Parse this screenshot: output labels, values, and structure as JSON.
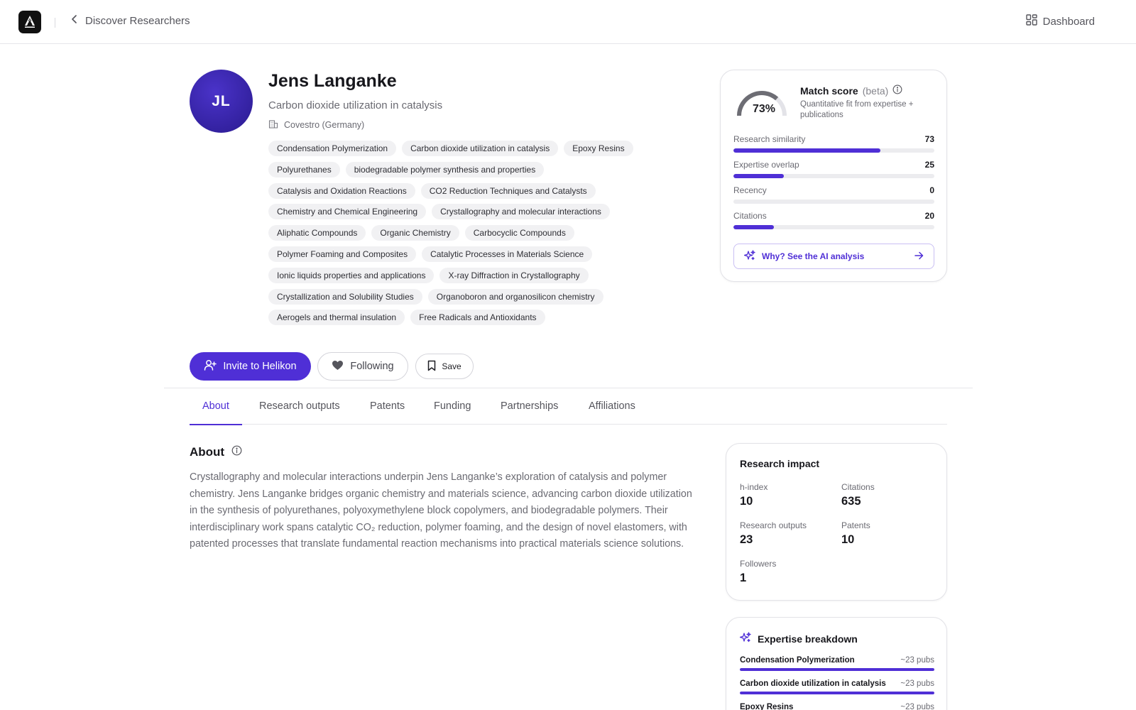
{
  "header": {
    "logo_icon": "helikon-labs-logo",
    "back_label": "Discover Researchers",
    "dashboard_label": "Dashboard"
  },
  "profile": {
    "initials": "JL",
    "name": "Jens Langanke",
    "subtitle": "Carbon dioxide utilization in catalysis",
    "organization": "Covestro (Germany)",
    "tags": [
      [
        "Condensation Polymerization",
        "Carbon dioxide utilization in catalysis",
        "Epoxy Resins"
      ],
      [
        "Polyurethanes",
        "biodegradable polymer synthesis and properties"
      ],
      [
        "Catalysis and Oxidation Reactions",
        "CO2 Reduction Techniques and Catalysts"
      ],
      [
        "Chemistry and Chemical Engineering",
        "Crystallography and molecular interactions"
      ],
      [
        "Aliphatic Compounds",
        "Organic Chemistry",
        "Carbocyclic Compounds"
      ],
      [
        "Polymer Foaming and Composites",
        "Catalytic Processes in Materials Science"
      ],
      [
        "Ionic liquids properties and applications",
        "X-ray Diffraction in Crystallography"
      ],
      [
        "Crystallization and Solubility Studies",
        "Organoboron and organosilicon chemistry"
      ],
      [
        "Aerogels and thermal insulation",
        "Free Radicals and Antioxidants"
      ]
    ]
  },
  "actions": {
    "invite_label": "Invite to Helikon",
    "following_label": "Following",
    "save_label": "Save"
  },
  "tabs": [
    {
      "label": "About",
      "active": true
    },
    {
      "label": "Research outputs",
      "active": false
    },
    {
      "label": "Patents",
      "active": false
    },
    {
      "label": "Funding",
      "active": false
    },
    {
      "label": "Partnerships",
      "active": false
    },
    {
      "label": "Affiliations",
      "active": false
    }
  ],
  "about": {
    "title": "About",
    "text": "Crystallography and molecular interactions underpin Jens Langanke’s exploration of catalysis and polymer chemistry. Jens Langanke bridges organic chemistry and materials science, advancing carbon dioxide utilization in the synthesis of polyurethanes, polyoxymethylene block copolymers, and biodegradable polymers. Their interdisciplinary work spans catalytic CO₂ reduction, polymer foaming, and the design of novel elastomers, with patented processes that translate fundamental reaction mechanisms into practical materials science solutions."
  },
  "match": {
    "score_value": 73,
    "score_label": "73%",
    "title": "Match score",
    "beta": "(beta)",
    "subtitle": "Quantitative fit from expertise + publications",
    "metrics": [
      {
        "label": "Research similarity",
        "value": "73",
        "fill": 0.73
      },
      {
        "label": "Expertise overlap",
        "value": "25",
        "fill": 0.25
      },
      {
        "label": "Recency",
        "value": "0",
        "fill": 0
      },
      {
        "label": "Citations",
        "value": "20",
        "fill": 0.2
      }
    ],
    "ai_label": "Why? See the AI analysis"
  },
  "impact": {
    "title": "Research impact",
    "stats": [
      {
        "label": "h-index",
        "value": "10"
      },
      {
        "label": "Citations",
        "value": "635"
      },
      {
        "label": "Research outputs",
        "value": "23"
      },
      {
        "label": "Patents",
        "value": "10"
      },
      {
        "label": "Followers",
        "value": "1"
      }
    ]
  },
  "expertise": {
    "title": "Expertise breakdown",
    "items": [
      {
        "name": "Condensation Polymerization",
        "count": "~23 pubs",
        "fill": 1.0
      },
      {
        "name": "Carbon dioxide utilization in catalysis",
        "count": "~23 pubs",
        "fill": 1.0
      },
      {
        "name": "Epoxy Resins",
        "count": "~23 pubs",
        "fill": 1.0
      }
    ]
  },
  "colors": {
    "accent": "#4f2fd6",
    "avatar": "#3a23b0",
    "track": "#ececef"
  }
}
